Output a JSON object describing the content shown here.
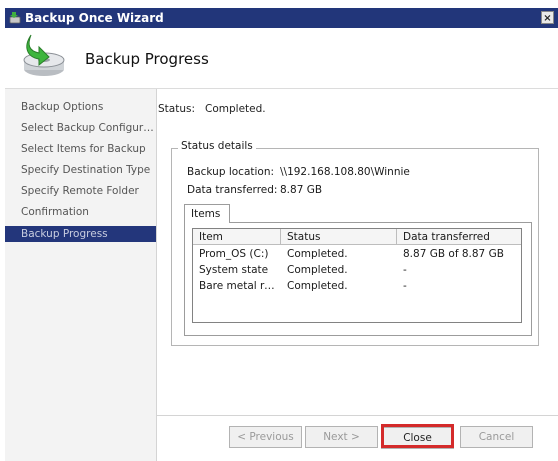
{
  "window": {
    "title": "Backup Once Wizard",
    "close_glyph": "×"
  },
  "header": {
    "title": "Backup Progress",
    "icon": "backup-drive-icon"
  },
  "sidebar": {
    "items": [
      {
        "label": "Backup Options",
        "active": false
      },
      {
        "label": "Select Backup Configur…",
        "active": false
      },
      {
        "label": "Select Items for Backup",
        "active": false
      },
      {
        "label": "Specify Destination Type",
        "active": false
      },
      {
        "label": "Specify Remote Folder",
        "active": false
      },
      {
        "label": "Confirmation",
        "active": false
      },
      {
        "label": "Backup Progress",
        "active": true
      }
    ]
  },
  "status": {
    "label": "Status:",
    "value": "Completed."
  },
  "details": {
    "legend": "Status details",
    "location_label": "Backup location:",
    "location_value": "\\\\192.168.108.80\\Winnie",
    "transferred_label": "Data transferred:",
    "transferred_value": "8.87 GB"
  },
  "tabs": {
    "items_label": "Items"
  },
  "table": {
    "headers": [
      "Item",
      "Status",
      "Data transferred"
    ],
    "rows": [
      [
        "Prom_OS (C:)",
        "Completed.",
        "8.87 GB of 8.87 GB"
      ],
      [
        "System state",
        "Completed.",
        "-"
      ],
      [
        "Bare metal rec…",
        "Completed.",
        "-"
      ]
    ]
  },
  "buttons": {
    "previous": "< Previous",
    "next": "Next >",
    "close": "Close",
    "cancel": "Cancel"
  },
  "colors": {
    "titlebar": "#22367a",
    "active_nav": "#23367b",
    "highlight": "#d42b2b"
  }
}
